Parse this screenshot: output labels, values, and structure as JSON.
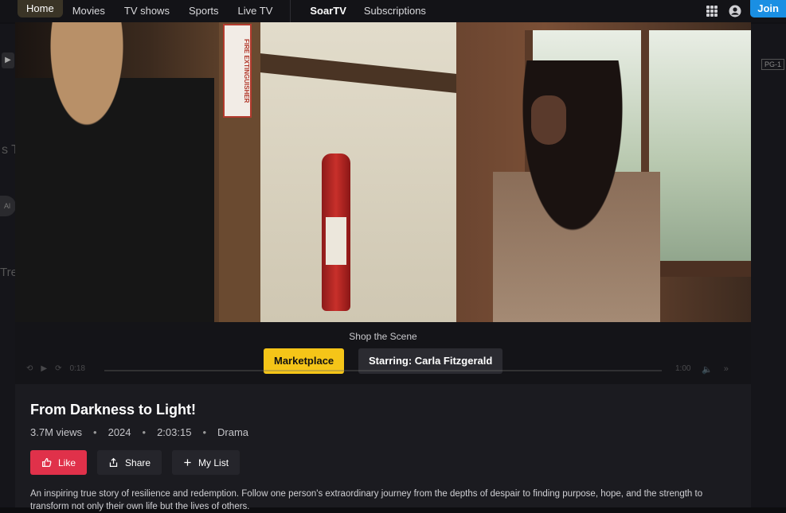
{
  "nav": {
    "items": [
      "Home",
      "Movies",
      "TV shows",
      "Sports",
      "Live TV"
    ],
    "brand": "SoarTV",
    "subscriptions": "Subscriptions",
    "join": "Join",
    "icons": [
      "apps-grid-icon",
      "user-account-icon"
    ]
  },
  "background": {
    "rating": "PG-1",
    "letter_s": "s T",
    "pill": "Al",
    "letter_tre": "Tre"
  },
  "player": {
    "current_time": "0:18",
    "duration": "1:00"
  },
  "shop": {
    "label": "Shop the Scene",
    "marketplace": "Marketplace",
    "starring": "Starring: Carla Fitzgerald"
  },
  "details": {
    "title": "From Darkness to Light!",
    "views": "3.7M views",
    "year": "2024",
    "runtime": "2:03:15",
    "genre": "Drama",
    "actions": {
      "like": "Like",
      "share": "Share",
      "my_list": "My List"
    },
    "description": "An inspiring true story of resilience and redemption. Follow one person's extraordinary journey from the depths of despair to finding purpose, hope, and the strength to transform not only their own life but the lives of others."
  },
  "colors": {
    "accent_yellow": "#f5c518",
    "like_red": "#e0314a",
    "join_blue": "#1a8fe3"
  }
}
